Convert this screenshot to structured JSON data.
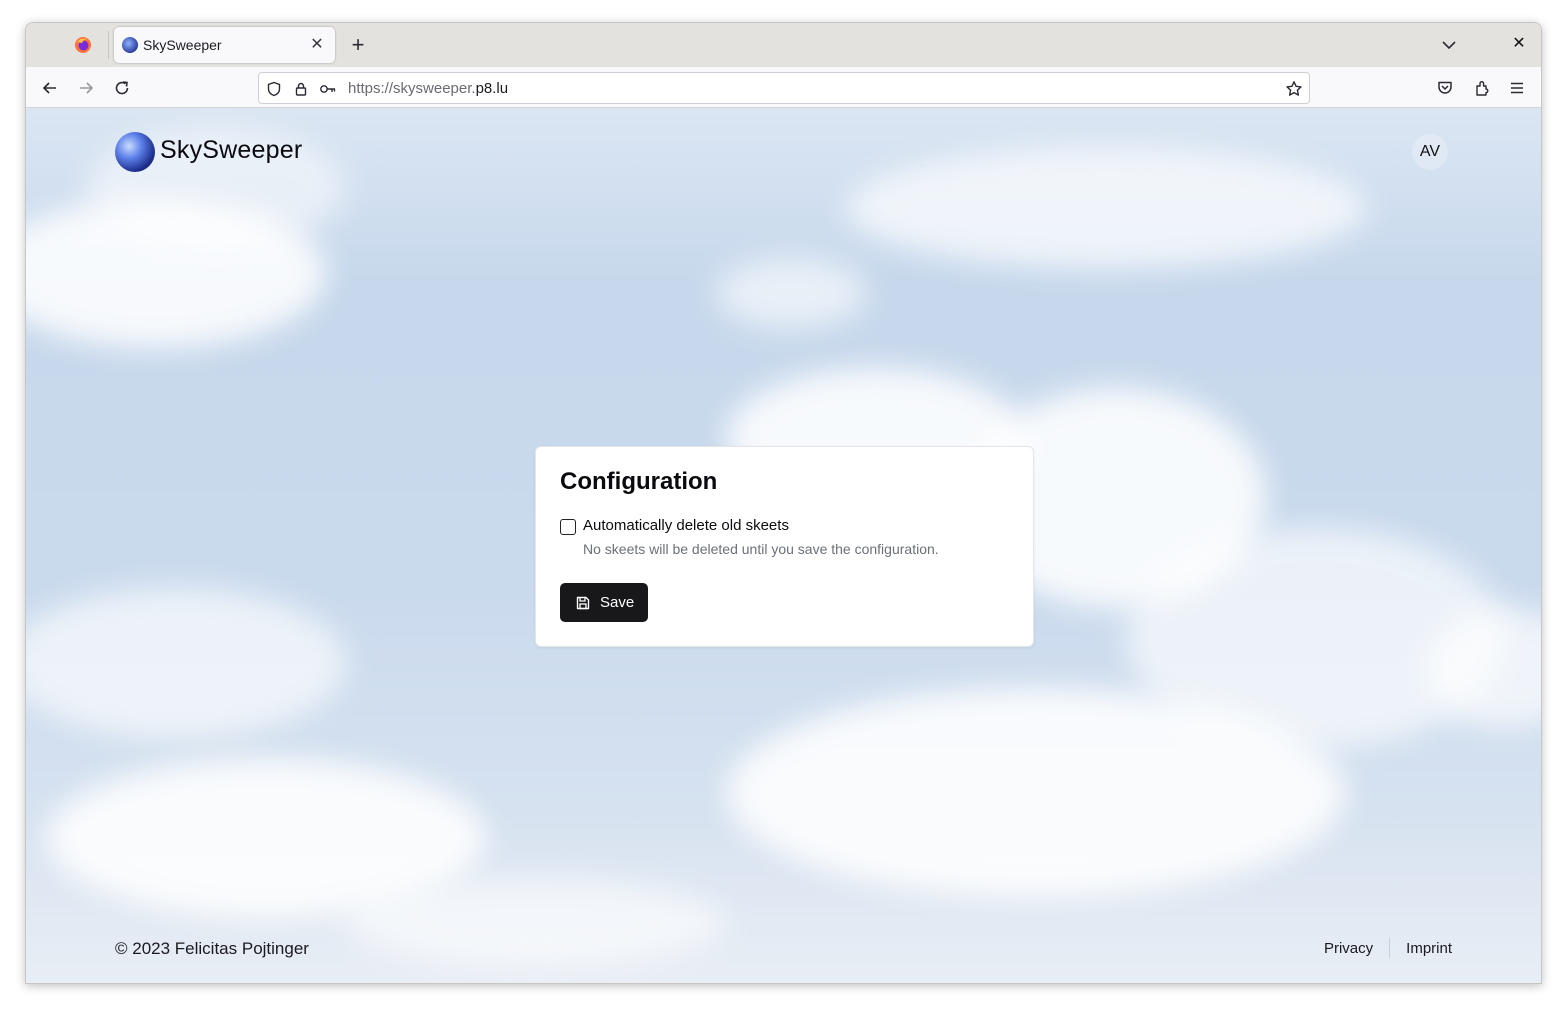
{
  "browser": {
    "tab": {
      "title": "SkySweeper",
      "close_glyph": "✕"
    },
    "new_tab_glyph": "+",
    "url": {
      "prefix": "https://skysweeper.",
      "host": "p8.lu"
    },
    "icons": [
      "firefox-icon",
      "back-arrow-icon",
      "forward-arrow-icon",
      "reload-icon",
      "shield-icon",
      "lock-icon",
      "key-icon",
      "star-icon",
      "pocket-icon",
      "extensions-icon",
      "menu-icon",
      "tabs-list-chevron-icon",
      "window-close-icon"
    ],
    "window_close_glyph": "✕"
  },
  "header": {
    "brand": "SkySweeper",
    "avatar_initials": "AV"
  },
  "config": {
    "title": "Configuration",
    "auto_delete_label": "Automatically delete old skeets",
    "auto_delete_checked": false,
    "auto_delete_help": "No skeets will be deleted until you save the configuration.",
    "save_label": "Save"
  },
  "footer": {
    "copyright": "© 2023 Felicitas Pojtinger",
    "links": [
      "Privacy",
      "Imprint"
    ]
  }
}
